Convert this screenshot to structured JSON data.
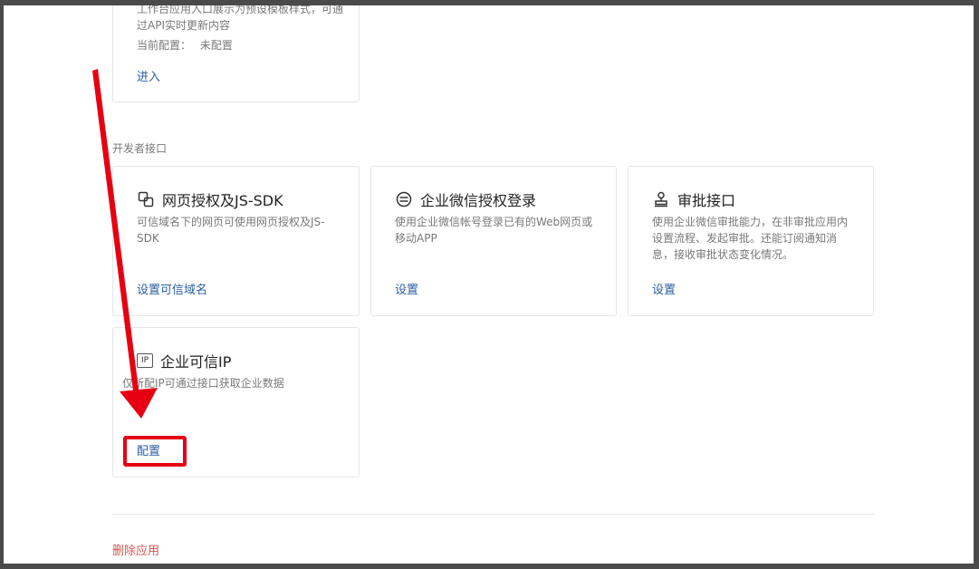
{
  "top_card": {
    "desc_partial": "工作台应用入口展示为预设模板样式，可通过API实时更新内容",
    "config_label": "当前配置：",
    "config_value": "未配置",
    "enter_link": "进入"
  },
  "developer_section": {
    "label": "开发者接口",
    "cards": [
      {
        "icon": "link-icon",
        "title": "网页授权及JS-SDK",
        "desc": "可信域名下的网页可使用网页授权及JS-SDK",
        "link": "设置可信域名"
      },
      {
        "icon": "exchange-icon",
        "title": "企业微信授权登录",
        "desc": "使用企业微信帐号登录已有的Web网页或移动APP",
        "link": "设置"
      },
      {
        "icon": "stamp-icon",
        "title": "审批接口",
        "desc": "使用企业微信审批能力，在非审批应用内设置流程、发起审批。还能订阅通知消息，接收审批状态变化情况。",
        "link": "设置"
      },
      {
        "icon": "ip-icon",
        "icon_text": "IP",
        "title": "企业可信IP",
        "desc": "仅所配IP可通过接口获取企业数据",
        "link": "配置"
      }
    ]
  },
  "delete_app": "删除应用",
  "colors": {
    "link": "#2b5fa3",
    "danger": "#d9534f",
    "annotation": "#e60012"
  }
}
